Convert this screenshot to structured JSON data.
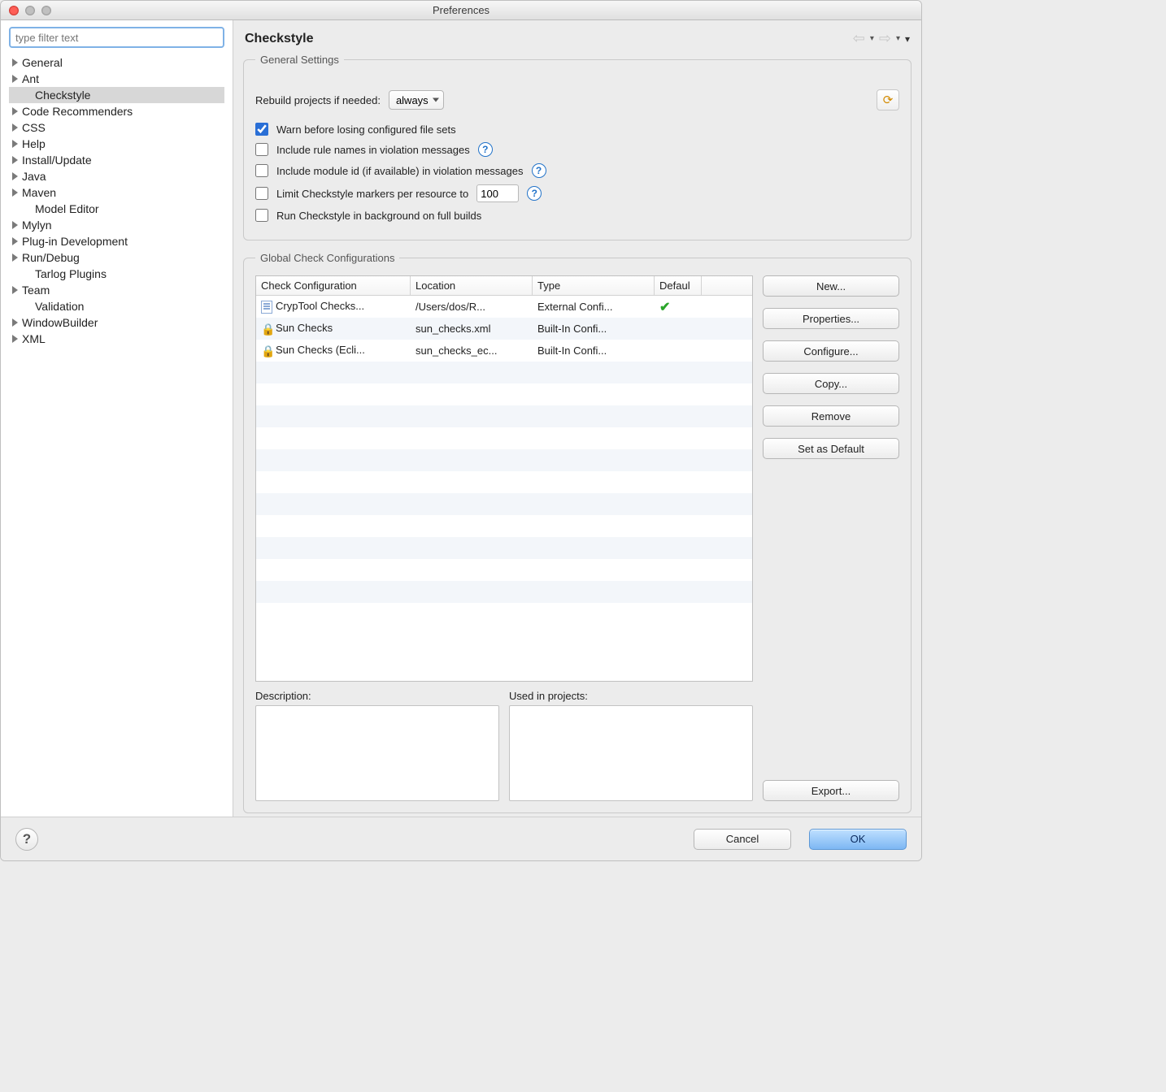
{
  "window": {
    "title": "Preferences"
  },
  "sidebar": {
    "filter_placeholder": "type filter text",
    "items": [
      {
        "label": "General",
        "expandable": true,
        "selected": false,
        "child": false
      },
      {
        "label": "Ant",
        "expandable": true,
        "selected": false,
        "child": false
      },
      {
        "label": "Checkstyle",
        "expandable": false,
        "selected": true,
        "child": true
      },
      {
        "label": "Code Recommenders",
        "expandable": true,
        "selected": false,
        "child": false
      },
      {
        "label": "CSS",
        "expandable": true,
        "selected": false,
        "child": false
      },
      {
        "label": "Help",
        "expandable": true,
        "selected": false,
        "child": false
      },
      {
        "label": "Install/Update",
        "expandable": true,
        "selected": false,
        "child": false
      },
      {
        "label": "Java",
        "expandable": true,
        "selected": false,
        "child": false
      },
      {
        "label": "Maven",
        "expandable": true,
        "selected": false,
        "child": false
      },
      {
        "label": "Model Editor",
        "expandable": false,
        "selected": false,
        "child": true
      },
      {
        "label": "Mylyn",
        "expandable": true,
        "selected": false,
        "child": false
      },
      {
        "label": "Plug-in Development",
        "expandable": true,
        "selected": false,
        "child": false
      },
      {
        "label": "Run/Debug",
        "expandable": true,
        "selected": false,
        "child": false
      },
      {
        "label": "Tarlog Plugins",
        "expandable": false,
        "selected": false,
        "child": true
      },
      {
        "label": "Team",
        "expandable": true,
        "selected": false,
        "child": false
      },
      {
        "label": "Validation",
        "expandable": false,
        "selected": false,
        "child": true
      },
      {
        "label": "WindowBuilder",
        "expandable": true,
        "selected": false,
        "child": false
      },
      {
        "label": "XML",
        "expandable": true,
        "selected": false,
        "child": false
      }
    ]
  },
  "page": {
    "title": "Checkstyle",
    "general_legend": "General Settings",
    "rebuild_label": "Rebuild projects if needed:",
    "rebuild_value": "always",
    "warn_label": "Warn before losing configured file sets",
    "include_rule_label": "Include rule names in violation messages",
    "include_module_label": "Include module id (if available) in violation messages",
    "limit_label": "Limit Checkstyle markers per resource to",
    "limit_value": "100",
    "run_bg_label": "Run Checkstyle in background on full builds",
    "global_legend": "Global Check Configurations",
    "columns": {
      "name": "Check Configuration",
      "location": "Location",
      "type": "Type",
      "default": "Defaul"
    },
    "rows": [
      {
        "icon": "doc",
        "name": "CrypTool Checks...",
        "location": "/Users/dos/R...",
        "type": "External Confi...",
        "default": true
      },
      {
        "icon": "lock",
        "name": "Sun Checks",
        "location": "sun_checks.xml",
        "type": "Built-In Confi...",
        "default": false
      },
      {
        "icon": "lock",
        "name": "Sun Checks (Ecli...",
        "location": "sun_checks_ec...",
        "type": "Built-In Confi...",
        "default": false
      }
    ],
    "buttons": {
      "new": "New...",
      "properties": "Properties...",
      "configure": "Configure...",
      "copy": "Copy...",
      "remove": "Remove",
      "set_default": "Set as Default",
      "export": "Export..."
    },
    "description_label": "Description:",
    "used_label": "Used in projects:"
  },
  "footer": {
    "cancel": "Cancel",
    "ok": "OK"
  }
}
